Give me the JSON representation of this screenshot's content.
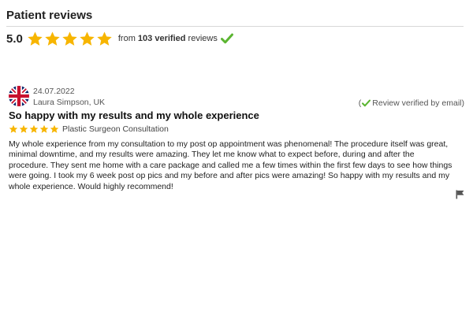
{
  "header": {
    "title": "Patient reviews"
  },
  "summary": {
    "score": "5.0",
    "rating": 5,
    "max_rating": 5,
    "from_text": "from",
    "count": "103",
    "verified_word": "verified",
    "reviews_word": "reviews",
    "icons": [
      "star-icon",
      "check-icon"
    ]
  },
  "review": {
    "flag_icon": "uk-flag-icon",
    "date": "24.07.2022",
    "author": "Laura Simpson, UK",
    "verified_open": "(",
    "verified_text": "Review verified by email)",
    "title": "So happy with my results and my whole experience",
    "rating": 5,
    "category": "Plastic Surgeon Consultation",
    "body": "My whole experience from my consultation to my post op appointment was phenomenal! The procedure itself was great, minimal downtime, and my results were amazing. They let me know what to expect before, during and after the procedure. They sent me home with a care package and called me a few times within the first few days to see how things were going. I took my 6 week post op pics and my before and after pics were amazing! So happy with my results and my whole experience. Would highly recommend!",
    "report_icon": "report-flag-icon"
  },
  "colors": {
    "star": "#f7b500",
    "check": "#5bb531",
    "flag_blue": "#012169",
    "flag_red": "#C8102E"
  }
}
